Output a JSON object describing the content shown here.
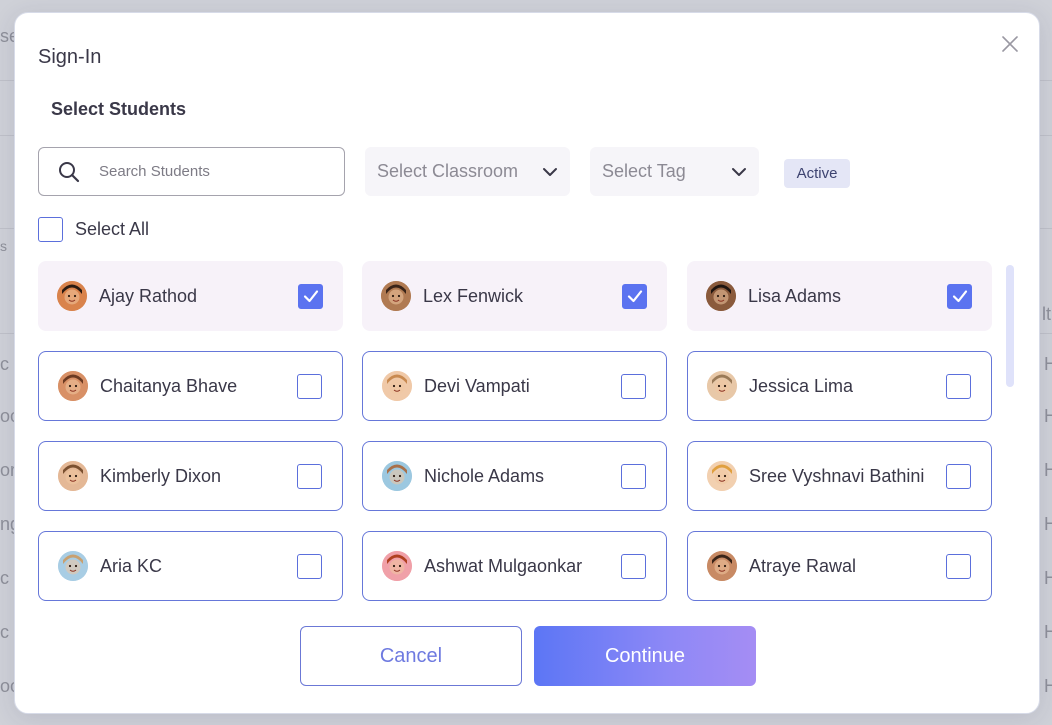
{
  "background": {
    "fragments": [
      "se",
      "s",
      "lt",
      "H",
      "H",
      "H",
      "H",
      "H",
      "H",
      "H",
      "c",
      "oo",
      "or",
      "ng",
      "c",
      "c",
      "oo"
    ]
  },
  "modal": {
    "title": "Sign-In",
    "section_title": "Select Students",
    "search": {
      "placeholder": "Search Students",
      "value": ""
    },
    "classroom_dropdown": {
      "label": "Select Classroom"
    },
    "tag_dropdown": {
      "label": "Select Tag"
    },
    "active_badge": "Active",
    "select_all": {
      "label": "Select All",
      "checked": false
    },
    "students": [
      {
        "name": "Ajay Rathod",
        "checked": true,
        "avatar_color": "#d9834c",
        "hair_color": "#2b1b12"
      },
      {
        "name": "Lex Fenwick",
        "checked": true,
        "avatar_color": "#b07a52",
        "hair_color": "#3a2418"
      },
      {
        "name": "Lisa Adams",
        "checked": true,
        "avatar_color": "#8a5a3c",
        "hair_color": "#1e1410"
      },
      {
        "name": "Chaitanya Bhave",
        "checked": false,
        "avatar_color": "#d89066",
        "hair_color": "#6b3a22"
      },
      {
        "name": "Devi Vampati",
        "checked": false,
        "avatar_color": "#f0c9a8",
        "hair_color": "#c98a50"
      },
      {
        "name": "Jessica Lima",
        "checked": false,
        "avatar_color": "#e8c8a8",
        "hair_color": "#9a7a58"
      },
      {
        "name": "Kimberly Dixon",
        "checked": false,
        "avatar_color": "#e4b896",
        "hair_color": "#7a5030"
      },
      {
        "name": "Nichole Adams",
        "checked": false,
        "avatar_color": "#9cc8e0",
        "hair_color": "#a8704a"
      },
      {
        "name": "Sree Vyshnavi Bathini",
        "checked": false,
        "avatar_color": "#f2d0b0",
        "hair_color": "#e0a040"
      },
      {
        "name": "Aria KC",
        "checked": false,
        "avatar_color": "#a8cde4",
        "hair_color": "#c8a070"
      },
      {
        "name": "Ashwat Mulgaonkar",
        "checked": false,
        "avatar_color": "#f0a0a8",
        "hair_color": "#b04020"
      },
      {
        "name": "Atraye Rawal",
        "checked": false,
        "avatar_color": "#c88a64",
        "hair_color": "#3a2418"
      }
    ],
    "buttons": {
      "cancel": "Cancel",
      "continue": "Continue"
    }
  },
  "colors": {
    "accent": "#5b73f0",
    "card_selected_bg": "#f7f2f9",
    "card_border": "#6677d9"
  }
}
